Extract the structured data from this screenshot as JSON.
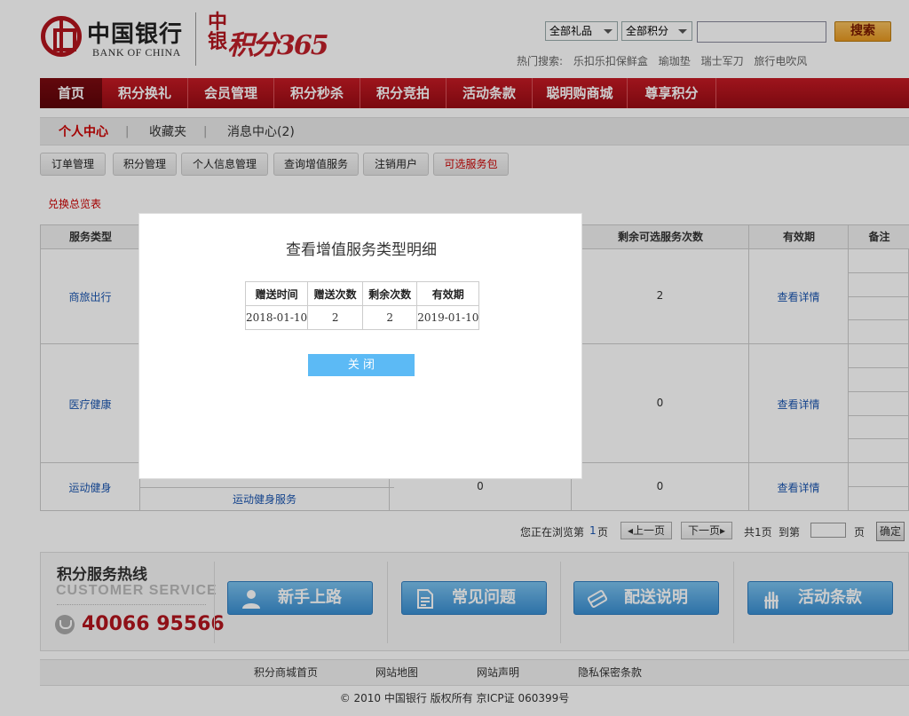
{
  "header": {
    "logo_cn": "中国银行",
    "logo_en": "BANK OF CHINA",
    "promo_side": "中银",
    "promo_main": "积分365",
    "search": {
      "gift_select": "全部礼品",
      "points_select": "全部积分",
      "button": "搜索",
      "hot_label": "热门搜索:",
      "hot_items": [
        "乐扣乐扣保鲜盒",
        "瑜珈垫",
        "瑞士军刀",
        "旅行电吹风"
      ]
    }
  },
  "nav": [
    "首页",
    "积分换礼",
    "会员管理",
    "积分秒杀",
    "积分竞拍",
    "活动条款",
    "聪明购商城",
    "尊享积分"
  ],
  "subnav": [
    "个人中心",
    "收藏夹",
    "消息中心(2)"
  ],
  "subnav_sep": "|",
  "tabs": [
    "订单管理",
    "积分管理",
    "个人信息管理",
    "查询增值服务",
    "注销用户",
    "可选服务包"
  ],
  "summary_link": "兑换总览表",
  "table": {
    "headers": [
      "服务类型",
      "剩余可选服务次数",
      "有效期",
      "备注"
    ],
    "rows": [
      {
        "type": "商旅出行",
        "remaining": "2",
        "detail": "查看详情"
      },
      {
        "type": "医疗健康",
        "remaining": "0",
        "detail": "查看详情"
      },
      {
        "type": "运动健身",
        "service": "运动健身服务",
        "count": "0",
        "remaining": "0",
        "detail": "查看详情"
      }
    ]
  },
  "pager": {
    "browsing": "您正在浏览第",
    "current": "1",
    "page_unit": "页",
    "prev": "上一页",
    "next": "下一页",
    "total": "共1页",
    "goto": "到第",
    "page_suffix": "页",
    "confirm": "确定"
  },
  "service": {
    "title": "积分服务热线",
    "subtitle": "CUSTOMER SERVICE",
    "phone": "40066 95566",
    "buttons": [
      "新手上路",
      "常见问题",
      "配送说明",
      "活动条款"
    ]
  },
  "footer": {
    "links": [
      "积分商城首页",
      "网站地图",
      "网站声明",
      "隐私保密条款"
    ],
    "copyright": "© 2010 中国银行 版权所有 京ICP证 060399号"
  },
  "modal": {
    "title": "查看增值服务类型明细",
    "headers": [
      "赠送时间",
      "赠送次数",
      "剩余次数",
      "有效期"
    ],
    "rows": [
      [
        "2018-01-10",
        "2",
        "2",
        "2019-01-10"
      ]
    ],
    "close": "关 闭"
  },
  "colors": {
    "brand_red": "#b3141d",
    "accent_blue": "#5cbaf5",
    "link_blue": "#1a55b0"
  }
}
